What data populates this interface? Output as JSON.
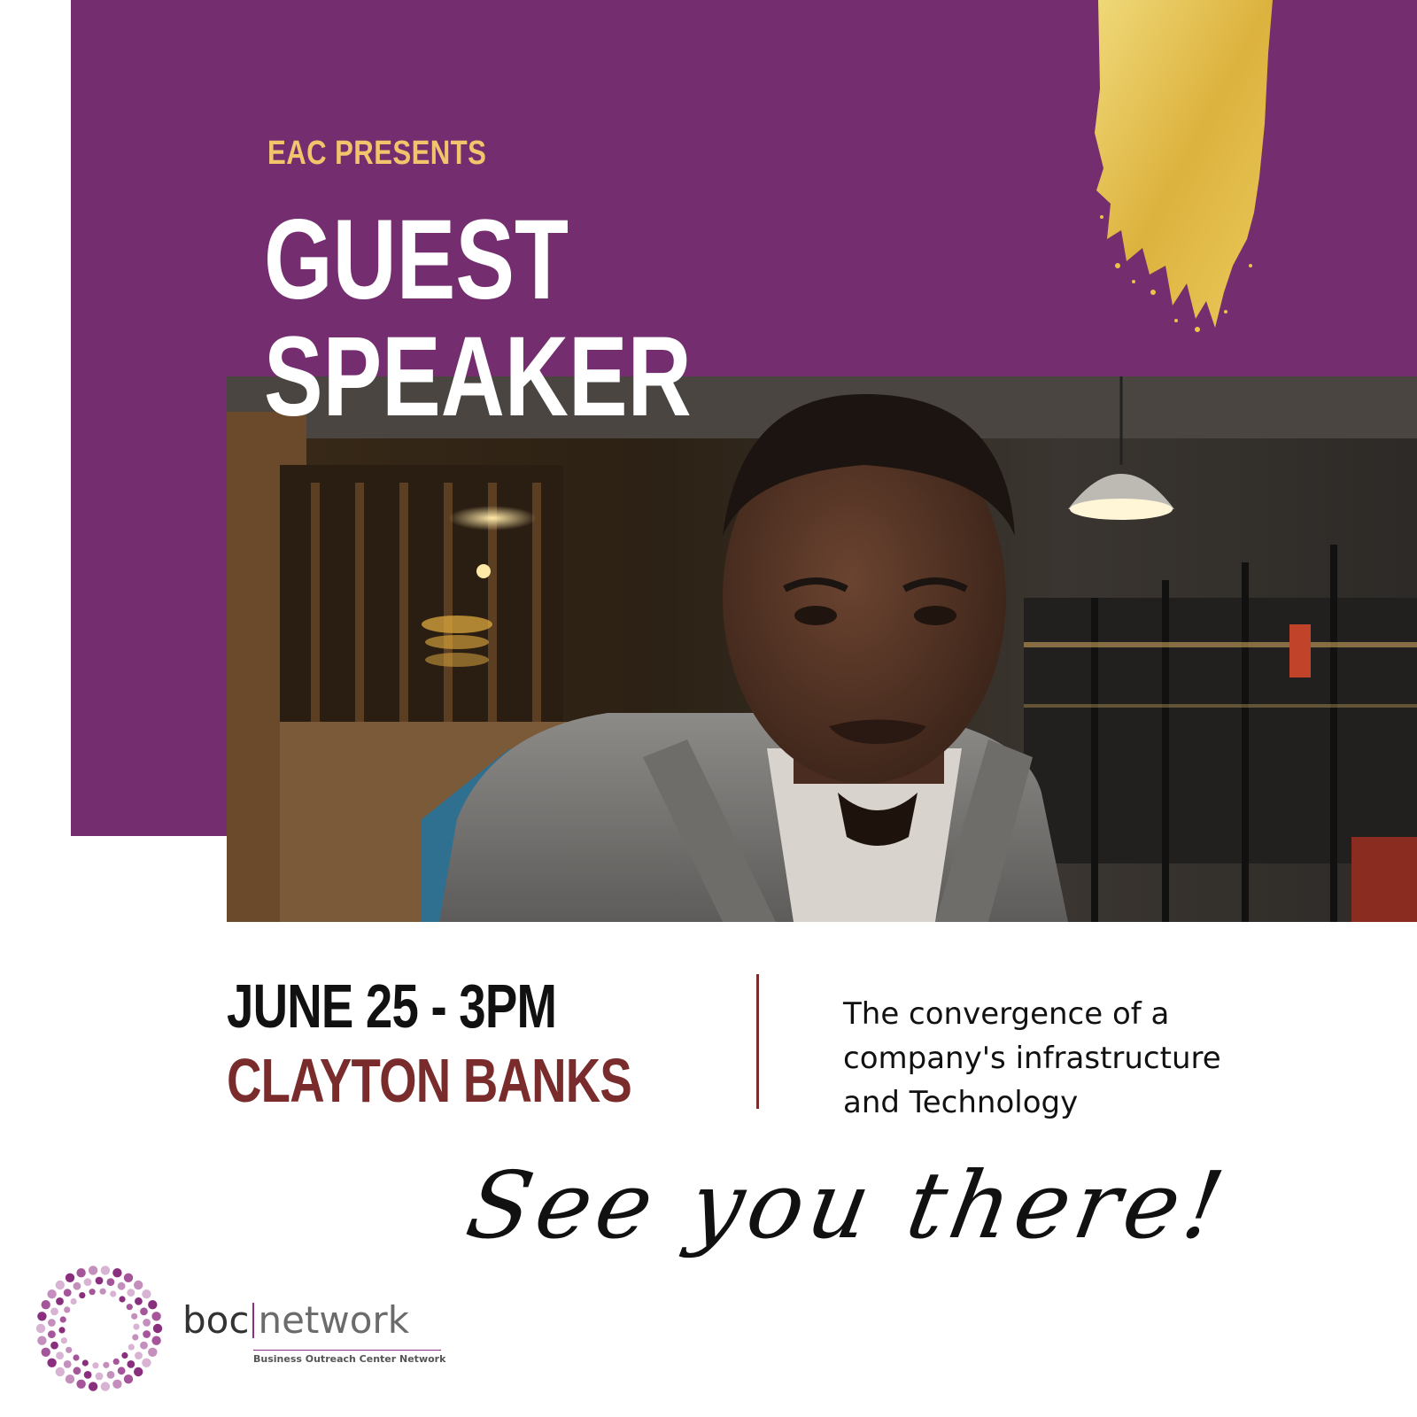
{
  "header": {
    "presents": "EAC PRESENTS",
    "headline": [
      "GUEST",
      "SPEAKER"
    ]
  },
  "event": {
    "date_time": "JUNE 25 - 3PM",
    "speaker": "CLAYTON BANKS",
    "topic": [
      "The convergence of a",
      "company's infrastructure",
      "and Technology"
    ]
  },
  "signoff": "See you there!",
  "logo": {
    "name_left": "boc",
    "name_right": "network",
    "tagline": "Business Outreach Center Network"
  },
  "colors": {
    "panel": "#742d6f",
    "accent_gold": "#f2c46b",
    "name_red": "#7a2c2c",
    "logo_purple": "#8a2f7e"
  }
}
